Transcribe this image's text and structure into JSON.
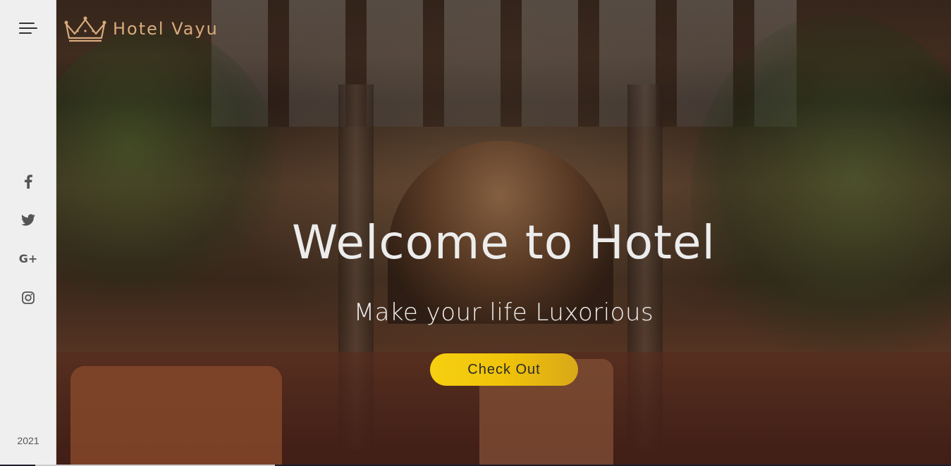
{
  "brand": {
    "name": "Hotel Vayu",
    "accent_color": "#d7ab7c",
    "logo_icon": "crown-icon"
  },
  "sidebar": {
    "menu_icon": "hamburger-menu-icon",
    "social": [
      {
        "name": "facebook",
        "icon": "facebook-icon"
      },
      {
        "name": "twitter",
        "icon": "twitter-icon"
      },
      {
        "name": "google-plus",
        "icon": "google-plus-icon",
        "glyph": "G+"
      },
      {
        "name": "instagram",
        "icon": "instagram-icon"
      }
    ],
    "year": "2021"
  },
  "hero": {
    "title": "Welcome to Hotel",
    "subtitle": "Make your life Luxorious",
    "cta_label": "Check Out",
    "cta_color": "#f6d011"
  }
}
